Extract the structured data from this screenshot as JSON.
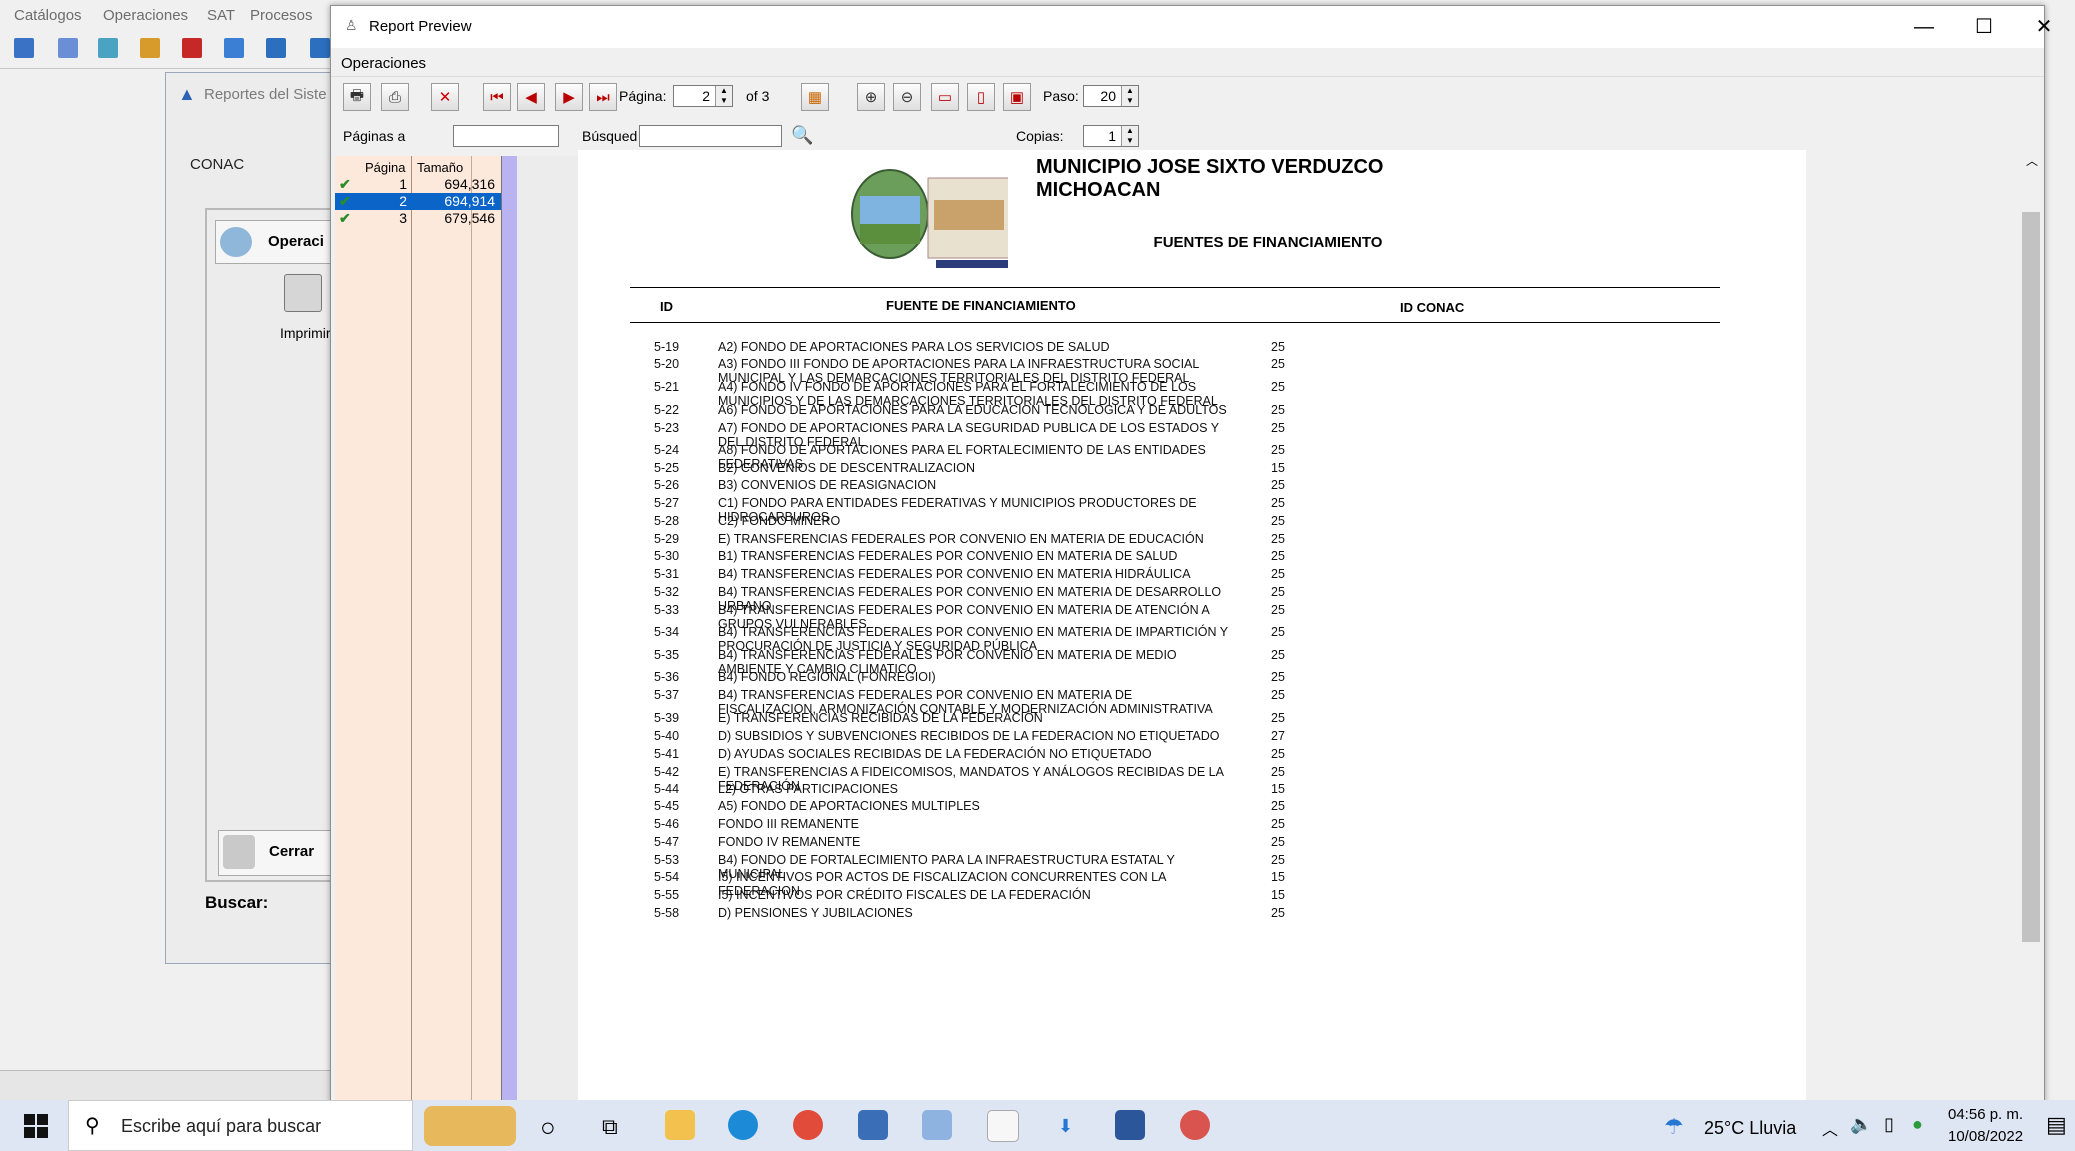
{
  "background_app": {
    "menu": [
      "Catálogos",
      "Operaciones",
      "SAT",
      "Procesos"
    ],
    "window_title": "Reportes del Siste",
    "tab": "CONAC",
    "operations_label": "Operaci",
    "print_label": "Imprimir",
    "close_label": "Cerrar",
    "search_label": "Buscar:"
  },
  "window": {
    "title": "Report Preview",
    "menu_operations": "Operaciones",
    "minimize": "—",
    "maximize": "☐",
    "close": "✕"
  },
  "toolbar": {
    "page_label": "Página:",
    "page_value": "2",
    "of_label": "of 3",
    "step_label": "Paso:",
    "step_value": "20",
    "pages_to_label": "Páginas a",
    "pages_to_value": "",
    "search_label": "Búsqued",
    "search_value": "",
    "copies_label": "Copias:",
    "copies_value": "1"
  },
  "page_list": {
    "col_page": "Página",
    "col_size": "Tamaño",
    "rows": [
      {
        "page": "1",
        "size": "694,316",
        "checked": true,
        "selected": false
      },
      {
        "page": "2",
        "size": "694,914",
        "checked": true,
        "selected": true
      },
      {
        "page": "3",
        "size": "679,546",
        "checked": true,
        "selected": false
      }
    ]
  },
  "report": {
    "municipality": "MUNICIPIO JOSE SIXTO VERDUZCO MICHOACAN",
    "subtitle": "FUENTES DE FINANCIAMIENTO",
    "col_id": "ID",
    "col_source": "FUENTE DE FINANCIAMIENTO",
    "col_conac": "ID CONAC",
    "rows": [
      {
        "id": "5-19",
        "desc": "A2) FONDO DE  APORTACIONES PARA LOS SERVICIOS DE SALUD",
        "conac": "25"
      },
      {
        "id": "5-20",
        "desc": "A3) FONDO III FONDO DE APORTACIONES PARA LA INFRAESTRUCTURA SOCIAL MUNICIPAL Y LAS DEMARCACIONES TERRITORIALES DEL DISTRITO FEDERAL",
        "conac": "25"
      },
      {
        "id": "5-21",
        "desc": "A4) FONDO IV FONDO DE APORTACIONES PARA EL FORTALECIMIENTO DE LOS MUNICIPIOS Y DE LAS DEMARCACIONES TERRITORIALES DEL DISTRITO FEDERAL",
        "conac": "25"
      },
      {
        "id": "5-22",
        "desc": "A6) FONDO DE APORTACIONES PARA LA EDUCACION TECNOLOGICA Y DE ADULTOS",
        "conac": "25"
      },
      {
        "id": "5-23",
        "desc": "A7) FONDO DE APORTACIONES PARA LA SEGURIDAD PUBLICA DE LOS ESTADOS Y DEL DISTRITO FEDERAL",
        "conac": "25"
      },
      {
        "id": "5-24",
        "desc": "A8) FONDO DE APORTACIONES PARA EL FORTALECIMIENTO DE LAS ENTIDADES FEDERATIVAS",
        "conac": "25"
      },
      {
        "id": "5-25",
        "desc": "B2) CONVENIOS DE DESCENTRALIZACION",
        "conac": "15"
      },
      {
        "id": "5-26",
        "desc": "B3) CONVENIOS DE REASIGNACION",
        "conac": "25"
      },
      {
        "id": "5-27",
        "desc": "C1) FONDO PARA ENTIDADES FEDERATIVAS Y MUNICIPIOS PRODUCTORES DE HIDROCARBUROS",
        "conac": "25"
      },
      {
        "id": "5-28",
        "desc": "C2) FONDO MINERO",
        "conac": "25"
      },
      {
        "id": "5-29",
        "desc": "E) TRANSFERENCIAS FEDERALES POR CONVENIO EN MATERIA DE EDUCACIÓN",
        "conac": "25"
      },
      {
        "id": "5-30",
        "desc": "B1) TRANSFERENCIAS FEDERALES POR CONVENIO EN MATERIA DE SALUD",
        "conac": "25"
      },
      {
        "id": "5-31",
        "desc": "B4) TRANSFERENCIAS FEDERALES POR CONVENIO EN MATERIA HIDRÁULICA",
        "conac": "25"
      },
      {
        "id": "5-32",
        "desc": "B4) TRANSFERENCIAS FEDERALES POR CONVENIO EN MATERIA DE DESARROLLO URBANO",
        "conac": "25"
      },
      {
        "id": "5-33",
        "desc": "B4) TRANSFERENCIAS FEDERALES POR CONVENIO EN MATERIA DE ATENCIÓN A GRUPOS VULNERABLES",
        "conac": "25"
      },
      {
        "id": "5-34",
        "desc": "B4) TRANSFERENCIAS FEDERALES POR CONVENIO EN MATERIA DE IMPARTICIÓN Y PROCURACIÓN DE JUSTICIA Y SEGURIDAD PÚBLICA",
        "conac": "25"
      },
      {
        "id": "5-35",
        "desc": "B4) TRANSFERENCIAS FEDERALES POR CONVENIO EN MATERIA DE MEDIO AMBIENTE Y CAMBIO CLIMATICO",
        "conac": "25"
      },
      {
        "id": "5-36",
        "desc": "B4) FONDO REGIONAL (FONREGIOI)",
        "conac": "25"
      },
      {
        "id": "5-37",
        "desc": "B4) TRANSFERENCIAS FEDERALES POR CONVENIO EN MATERIA DE FISCALIZACION, ARMONIZACIÓN CONTABLE Y MODERNIZACIÓN ADMINISTRATIVA",
        "conac": "25"
      },
      {
        "id": "5-39",
        "desc": "E) TRANSFERENCIAS RECIBIDAS DE LA FEDERACIÓN",
        "conac": "25"
      },
      {
        "id": "5-40",
        "desc": "D) SUBSIDIOS Y SUBVENCIONES RECIBIDOS DE LA FEDERACION NO ETIQUETADO",
        "conac": "27"
      },
      {
        "id": "5-41",
        "desc": "D) AYUDAS SOCIALES RECIBIDAS DE LA FEDERACIÓN NO ETIQUETADO",
        "conac": "25"
      },
      {
        "id": "5-42",
        "desc": "E) TRANSFERENCIAS A FIDEICOMISOS, MANDATOS Y ANÁLOGOS RECIBIDAS DE LA FEDERACIÓN",
        "conac": "25"
      },
      {
        "id": "5-44",
        "desc": "L2) OTRAS PARTICIPACIONES",
        "conac": "15"
      },
      {
        "id": "5-45",
        "desc": "A5) FONDO DE APORTACIONES MULTIPLES",
        "conac": "25"
      },
      {
        "id": "5-46",
        "desc": "FONDO III REMANENTE",
        "conac": "25"
      },
      {
        "id": "5-47",
        "desc": "FONDO IV REMANENTE",
        "conac": "25"
      },
      {
        "id": "5-53",
        "desc": "B4) FONDO DE FORTALECIMIENTO PARA LA INFRAESTRUCTURA ESTATAL Y MUNICIPAL",
        "conac": "25"
      },
      {
        "id": "5-54",
        "desc": "I5) INCENTIVOS POR ACTOS DE FISCALIZACION CONCURRENTES CON LA FEDERACION",
        "conac": "15"
      },
      {
        "id": "5-55",
        "desc": "I5) INCENTIVOS POR CRÉDITO FISCALES DE LA FEDERACIÓN",
        "conac": "15"
      },
      {
        "id": "5-58",
        "desc": "D) PENSIONES Y JUBILACIONES",
        "conac": "25"
      }
    ]
  },
  "taskbar": {
    "search_placeholder": "Escribe aquí para buscar",
    "weather": "25°C  Lluvia",
    "time": "04:56 p. m.",
    "date": "10/08/2022"
  }
}
